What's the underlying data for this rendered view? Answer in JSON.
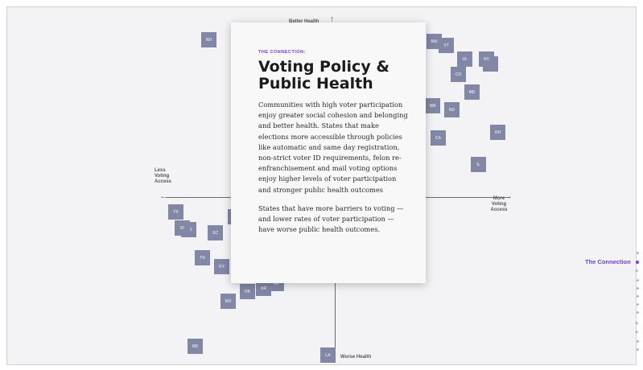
{
  "axes": {
    "top_label": "Better Health",
    "bottom_label": "Worse Health",
    "left_label": "Less Voting Access",
    "right_label": "More Voting Access"
  },
  "states": [
    {
      "abbr": "NH"
    },
    {
      "abbr": "MA"
    },
    {
      "abbr": "VT"
    },
    {
      "abbr": "IA"
    },
    {
      "abbr": "WA"
    },
    {
      "abbr": "CO"
    },
    {
      "abbr": "MD"
    },
    {
      "abbr": "ND"
    },
    {
      "abbr": "CA"
    },
    {
      "abbr": "OH"
    },
    {
      "abbr": "IL"
    },
    {
      "abbr": "TX"
    },
    {
      "abbr": "MO"
    },
    {
      "abbr": "SC"
    },
    {
      "abbr": "TN"
    },
    {
      "abbr": "KY"
    },
    {
      "abbr": "OK"
    },
    {
      "abbr": "WV"
    },
    {
      "abbr": "MS"
    },
    {
      "abbr": "LA"
    },
    {
      "abbr": "ID"
    },
    {
      "abbr": "NM"
    },
    {
      "abbr": "AR"
    },
    {
      "abbr": "AL"
    },
    {
      "abbr": "NY"
    },
    {
      "abbr": "NJ"
    }
  ],
  "card": {
    "eyebrow": "THE CONNECTION:",
    "title_line1": "Voting Policy &",
    "title_line2": "Public Health",
    "paragraph1": "Communities with high voter participation enjoy greater social cohesion and belonging and better health. States that make elections more accessible through policies like automatic and same day registration, non-strict voter ID requirements, felon re-enfranchisement and mail voting options enjoy higher levels of voter participation and stronger public health outcomes",
    "paragraph2": "States that have more barriers to voting —and lower rates of voter participation —have worse public health outcomes."
  },
  "nav": {
    "active_label": "The Connection"
  },
  "colors": {
    "accent": "#6d3fd8",
    "state_tile": "#8187a5"
  }
}
